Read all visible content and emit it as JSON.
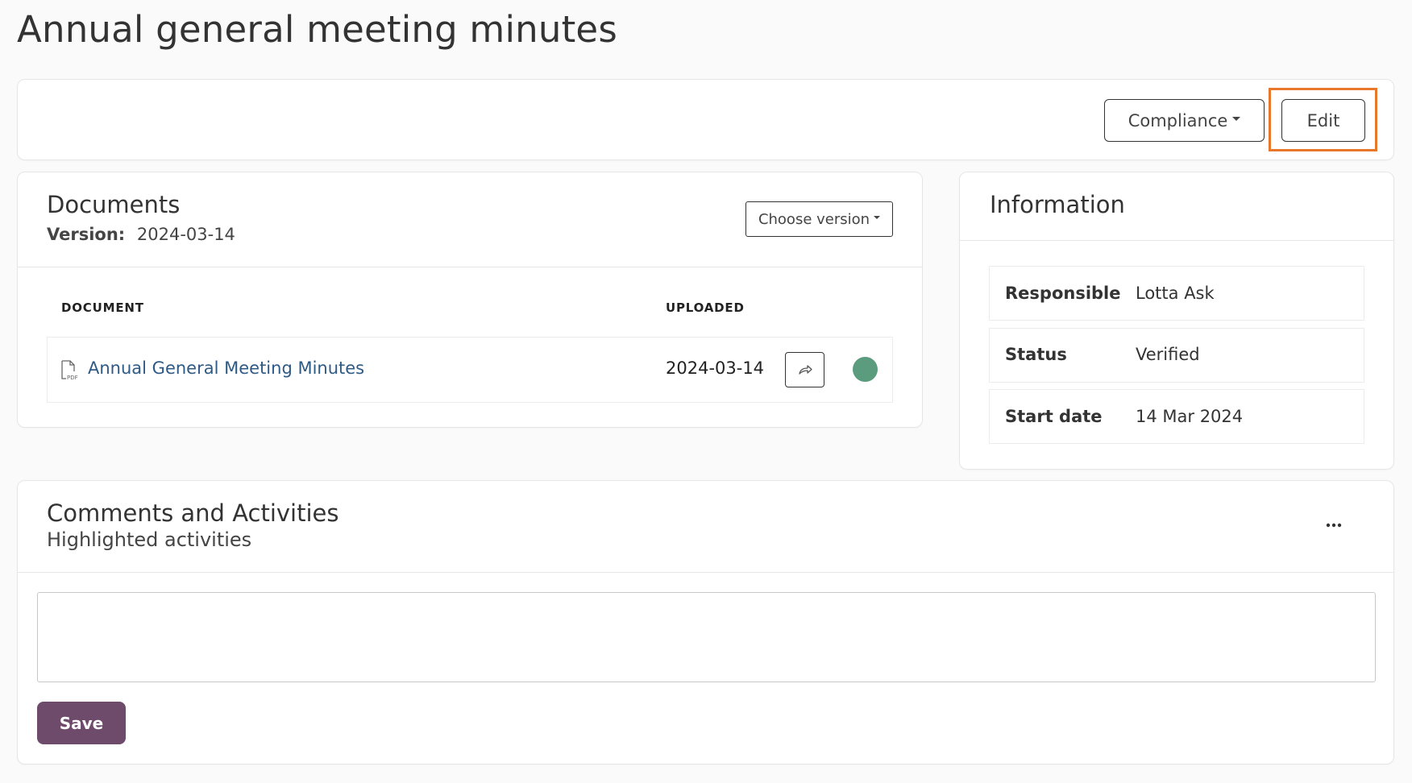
{
  "page": {
    "title": "Annual general meeting minutes"
  },
  "toolbar": {
    "compliance_label": "Compliance",
    "edit_label": "Edit"
  },
  "documents": {
    "title": "Documents",
    "version_label": "Version:",
    "version_value": "2024-03-14",
    "choose_version_label": "Choose version",
    "columns": {
      "document": "DOCUMENT",
      "uploaded": "UPLOADED"
    },
    "rows": [
      {
        "name": "Annual General Meeting Minutes",
        "uploaded": "2024-03-14",
        "status_color": "#5a9c7d",
        "file_icon": "pdf-file-icon"
      }
    ]
  },
  "information": {
    "title": "Information",
    "fields": [
      {
        "label": "Responsible",
        "value": "Lotta Ask"
      },
      {
        "label": "Status",
        "value": "Verified"
      },
      {
        "label": "Start date",
        "value": "14 Mar 2024"
      }
    ]
  },
  "comments": {
    "title": "Comments and Activities",
    "subtitle": "Highlighted activities",
    "more_icon": "more-horizontal-icon",
    "input_value": "",
    "save_label": "Save"
  },
  "colors": {
    "accent": "#6e4a6b",
    "focus": "#e9772b",
    "link": "#2e5a86",
    "status_ok": "#5a9c7d"
  }
}
